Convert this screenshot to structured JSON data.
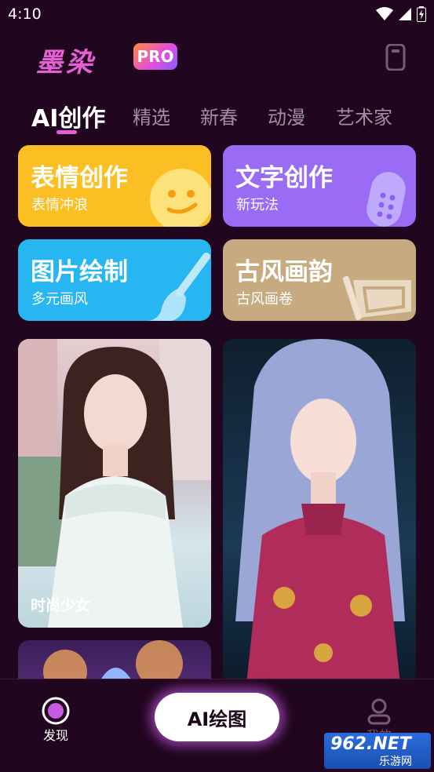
{
  "status_bar": {
    "time": "4:10"
  },
  "header": {
    "logo_text": "墨染",
    "badge": "PRO"
  },
  "tabs": [
    {
      "label": "AI创作",
      "active": true
    },
    {
      "label": "精选",
      "active": false
    },
    {
      "label": "新春",
      "active": false
    },
    {
      "label": "动漫",
      "active": false
    },
    {
      "label": "艺术家",
      "active": false
    }
  ],
  "feature_cards": [
    {
      "title": "表情创作",
      "subtitle": "表情冲浪",
      "color": "#fbbf24"
    },
    {
      "title": "文字创作",
      "subtitle": "新玩法",
      "color": "#9a6cf5"
    },
    {
      "title": "图片绘制",
      "subtitle": "多元画风",
      "color": "#27b6f2"
    },
    {
      "title": "古风画韵",
      "subtitle": "古风画卷",
      "color": "#c7aa80"
    }
  ],
  "gallery": [
    {
      "label": "时尚少女"
    }
  ],
  "bottom_nav": {
    "discover_label": "发现",
    "ai_button_label": "AI绘图",
    "profile_label": "我的"
  },
  "watermark": {
    "brand": "962.NET",
    "sub": "乐游网"
  },
  "colors": {
    "background": "#21061f",
    "accent": "#e85bd8"
  }
}
